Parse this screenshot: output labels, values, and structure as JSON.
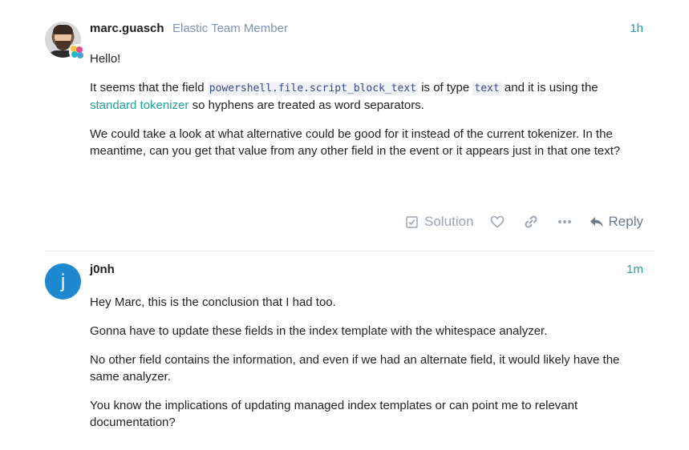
{
  "posts": [
    {
      "username": "marc.guasch",
      "user_title": "Elastic Team Member",
      "time": "1h",
      "paragraphs": {
        "p1": "Hello!",
        "p2a": "It seems that the field ",
        "p2_code1": "powershell.file.script_block_text",
        "p2b": " is of type ",
        "p2_code2": "text",
        "p2c": " and it is using the ",
        "p2_link": "standard tokenizer",
        "p2d": " so hyphens are treated as word separators.",
        "p3": "We could take a look at what alternative could be good for it instead of the current tokenizer. In the meantime, can you get that value from any other field in the event or it appears just in that one text?"
      },
      "actions": {
        "solution_label": "Solution",
        "reply_label": "Reply"
      }
    },
    {
      "username": "j0nh",
      "avatar_letter": "j",
      "time": "1m",
      "paragraphs": {
        "p1": "Hey Marc, this is the conclusion that I had too.",
        "p2": "Gonna have to update these fields in the index template with the whitespace analyzer.",
        "p3": "No other field contains the information, and even if we had an alternate field, it would likely have the same analyzer.",
        "p4": "You know the implications of updating managed index templates or can point me to relevant documentation?"
      }
    }
  ],
  "icons": {
    "solution": "checkbox-icon",
    "like": "heart-icon",
    "share": "link-icon",
    "more": "ellipsis-icon",
    "reply": "reply-arrow-icon"
  },
  "colors": {
    "accent": "#1fa39a",
    "user_title": "#7d93b5",
    "avatar_j": "#1e88d1",
    "code_bg": "#eef1f6",
    "action_gray": "#9aa5b1"
  }
}
